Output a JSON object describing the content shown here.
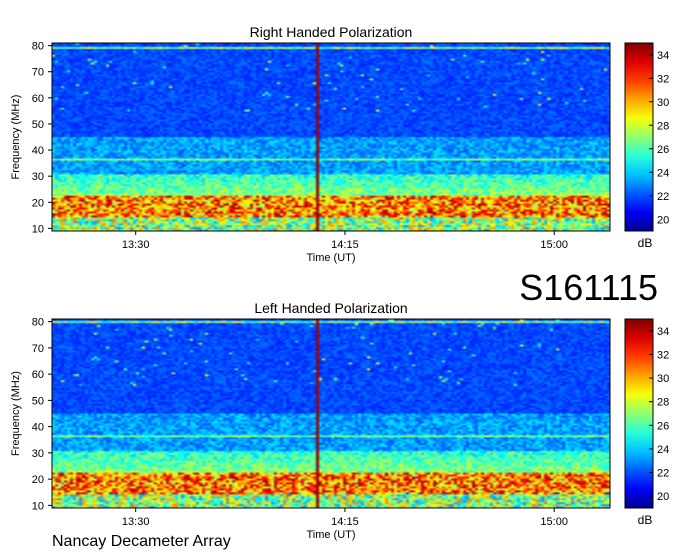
{
  "page": {
    "event_id": "S161115",
    "footer": "Nancay Decameter Array"
  },
  "chart_data": [
    {
      "type": "heatmap",
      "title": "Right Handed Polarization",
      "xlabel": "Time (UT)",
      "ylabel": "Frequency (MHz)",
      "x_ticks": [
        "13:30",
        "14:15",
        "15:00"
      ],
      "y_ticks": [
        10,
        20,
        30,
        40,
        50,
        60,
        70,
        80
      ],
      "ylim": [
        9,
        81
      ],
      "x_range_minutes": [
        "13:12",
        "15:12"
      ],
      "colorbar": {
        "label": "dB",
        "ticks": [
          20,
          22,
          24,
          26,
          28,
          30,
          32,
          34
        ],
        "range": [
          19,
          35
        ]
      },
      "features": {
        "vertical_burst_time": "14:09",
        "strong_bands_mhz": [
          [
            13,
            22
          ]
        ],
        "moderate_bands_mhz": [
          [
            22,
            30
          ],
          [
            36,
            37
          ]
        ],
        "top_line_mhz": 79
      }
    },
    {
      "type": "heatmap",
      "title": "Left Handed Polarization",
      "xlabel": "Time (UT)",
      "ylabel": "Frequency (MHz)",
      "x_ticks": [
        "13:30",
        "14:15",
        "15:00"
      ],
      "y_ticks": [
        10,
        20,
        30,
        40,
        50,
        60,
        70,
        80
      ],
      "ylim": [
        9,
        81
      ],
      "x_range_minutes": [
        "13:12",
        "15:12"
      ],
      "colorbar": {
        "label": "dB",
        "ticks": [
          20,
          22,
          24,
          26,
          28,
          30,
          32,
          34
        ],
        "range": [
          19,
          35
        ]
      },
      "features": {
        "vertical_burst_time": "14:09",
        "strong_bands_mhz": [
          [
            13,
            22
          ]
        ],
        "moderate_bands_mhz": [
          [
            22,
            32
          ],
          [
            36,
            37
          ]
        ],
        "top_line_mhz": 80
      }
    }
  ]
}
